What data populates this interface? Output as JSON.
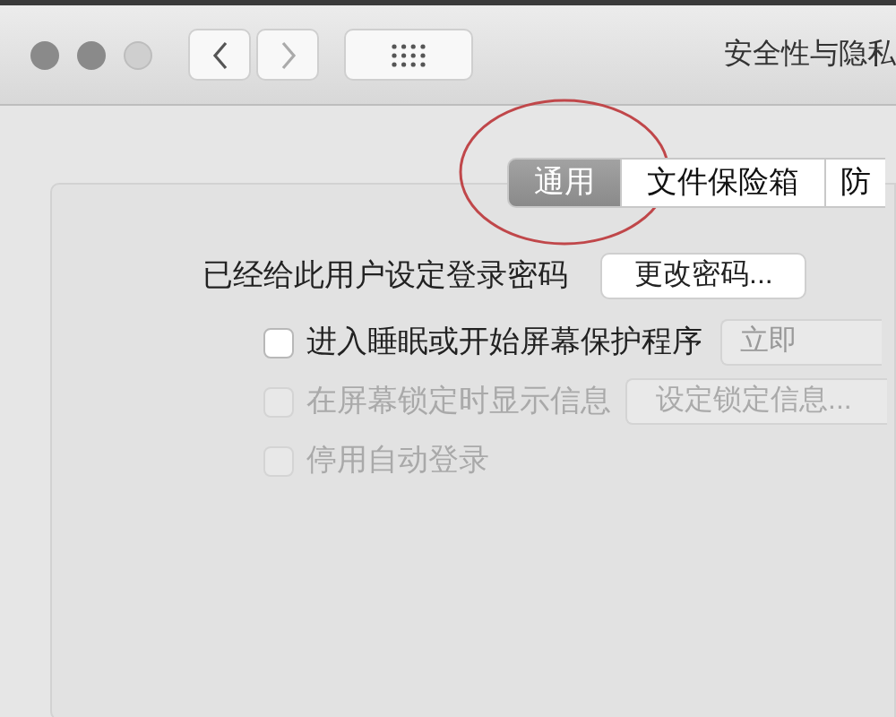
{
  "window": {
    "traffic_lights": [
      {
        "disabled": false
      },
      {
        "disabled": false
      },
      {
        "disabled": true
      }
    ],
    "title": "安全性与隐私"
  },
  "tabs": [
    {
      "label": "通用",
      "selected": true
    },
    {
      "label": "文件保险箱",
      "selected": false
    },
    {
      "label": "防",
      "selected": false
    }
  ],
  "password": {
    "label": "已经给此用户设定登录密码",
    "button": "更改密码..."
  },
  "options": [
    {
      "label": "进入睡眠或开始屏幕保护程序",
      "checked": false,
      "disabled": false,
      "popup": "立即"
    },
    {
      "label": "在屏幕锁定时显示信息",
      "checked": false,
      "disabled": true,
      "button": "设定锁定信息..."
    },
    {
      "label": "停用自动登录",
      "checked": false,
      "disabled": true
    }
  ],
  "annotation": {
    "kind": "circle"
  }
}
